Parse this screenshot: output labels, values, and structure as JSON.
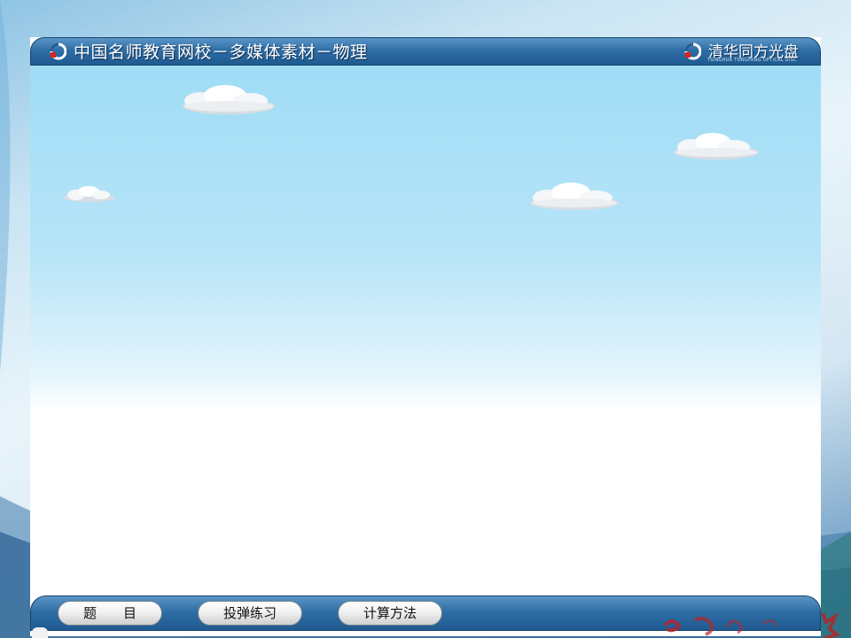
{
  "header": {
    "title": "中国名师教育网校－多媒体素材－物理",
    "brand": "清华同方光盘",
    "brand_sub": "TSINGHUA TONGFANG OPTICAL DISC",
    "left_logo_icon": "disc-logo-icon",
    "right_logo_icon": "disc-logo-icon"
  },
  "bottom_nav": {
    "buttons": [
      {
        "label": "题　　目"
      },
      {
        "label": "投弹练习"
      },
      {
        "label": "计算方法"
      }
    ]
  },
  "scene": {
    "clouds": 4,
    "sky_color_top": "#9fdcf6",
    "bar_color": "#2f6ea6"
  }
}
